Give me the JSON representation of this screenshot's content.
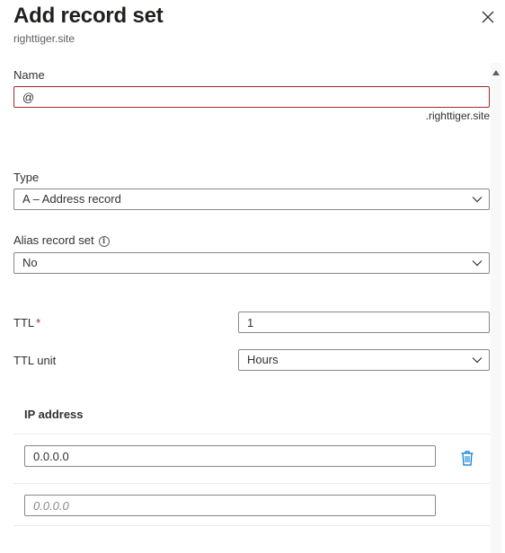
{
  "header": {
    "title": "Add record set",
    "subtitle": "righttiger.site"
  },
  "form": {
    "name_label": "Name",
    "name_value": "@",
    "name_suffix": ".righttiger.site",
    "type_label": "Type",
    "type_value": "A – Address record",
    "alias_label": "Alias record set",
    "alias_value": "No",
    "ttl_label": "TTL",
    "ttl_required": "*",
    "ttl_value": "1",
    "ttl_unit_label": "TTL unit",
    "ttl_unit_value": "Hours"
  },
  "ip_section": {
    "header": "IP address",
    "rows": [
      {
        "value": "0.0.0.0",
        "placeholder": ""
      },
      {
        "value": "",
        "placeholder": "0.0.0.0"
      }
    ]
  },
  "colors": {
    "error_border": "#a4262c",
    "accent": "#0078d4",
    "required": "#a4262c"
  }
}
